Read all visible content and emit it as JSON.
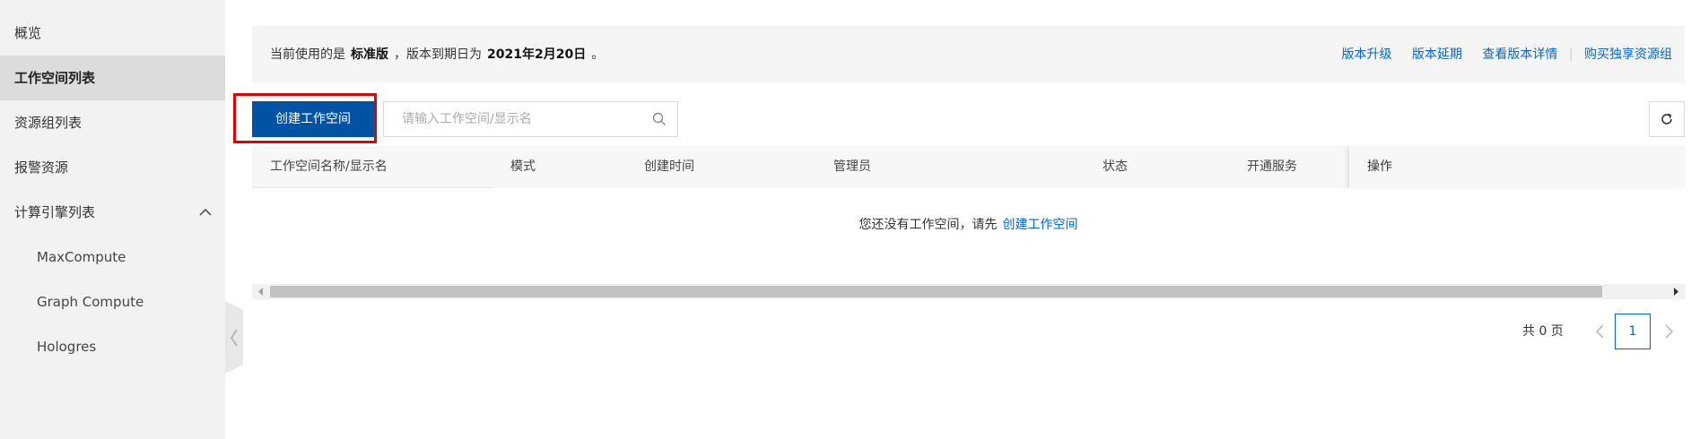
{
  "sidebar": {
    "items": [
      {
        "label": "概览"
      },
      {
        "label": "工作空间列表"
      },
      {
        "label": "资源组列表"
      },
      {
        "label": "报警资源"
      },
      {
        "label": "计算引擎列表"
      },
      {
        "label": "MaxCompute"
      },
      {
        "label": "Graph Compute"
      },
      {
        "label": "Hologres"
      }
    ]
  },
  "notice": {
    "prefix": "当前使用的是",
    "edition": "标准版",
    "middle": "，版本到期日为",
    "expiry_date": "2021年2月20日",
    "suffix": "。",
    "links": {
      "upgrade": "版本升级",
      "extend": "版本延期",
      "details": "查看版本详情",
      "buy": "购买独享资源组"
    }
  },
  "toolbar": {
    "create_label": "创建工作空间",
    "search_placeholder": "请输入工作空间/显示名"
  },
  "table": {
    "columns": [
      "工作空间名称/显示名",
      "模式",
      "创建时间",
      "管理员",
      "状态",
      "开通服务",
      "操作"
    ],
    "empty_text": "您还没有工作空间，请先",
    "empty_link": "创建工作空间"
  },
  "pagination": {
    "total_text": "共 0 页",
    "current_page": "1"
  },
  "colors": {
    "primary": "#0052a3",
    "link": "#0066cc",
    "highlight": "#e00000"
  }
}
